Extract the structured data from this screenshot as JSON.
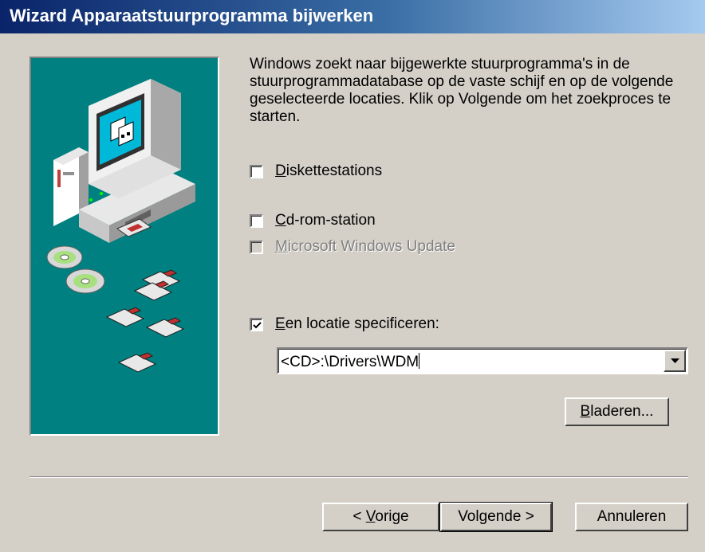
{
  "window": {
    "title": "Wizard Apparaatstuurprogramma bijwerken"
  },
  "main": {
    "description": "Windows zoekt naar bijgewerkte stuurprogramma's in de stuurprogrammadatabase op de vaste schijf en op de volgende geselecteerde locaties. Klik op Volgende om het zoekproces te starten.",
    "options": [
      {
        "accel": "D",
        "rest": "iskettestations",
        "checked": false,
        "enabled": true
      },
      {
        "accel": "C",
        "rest": "d-rom-station",
        "checked": false,
        "enabled": true
      },
      {
        "accel": "M",
        "rest": "icrosoft Windows Update",
        "checked": false,
        "enabled": false
      },
      {
        "accel": "E",
        "rest": "en locatie specificeren:",
        "checked": true,
        "enabled": true
      }
    ],
    "location_value": "<CD>:\\Drivers\\WDM"
  },
  "buttons": {
    "browse": {
      "accel": "B",
      "rest": "laderen..."
    },
    "back": {
      "prefix": "< ",
      "accel": "V",
      "rest": "orige"
    },
    "next": "Volgende >",
    "cancel": "Annuleren"
  },
  "icons": [
    "computer-icon",
    "cd-icon",
    "floppy-disk-icon",
    "checkmark-icon",
    "dropdown-arrow-icon"
  ],
  "colors": {
    "titlebar_start": "#0a246a",
    "titlebar_end": "#a6caf0",
    "panel": "#008080",
    "face": "#d4d0c8"
  }
}
